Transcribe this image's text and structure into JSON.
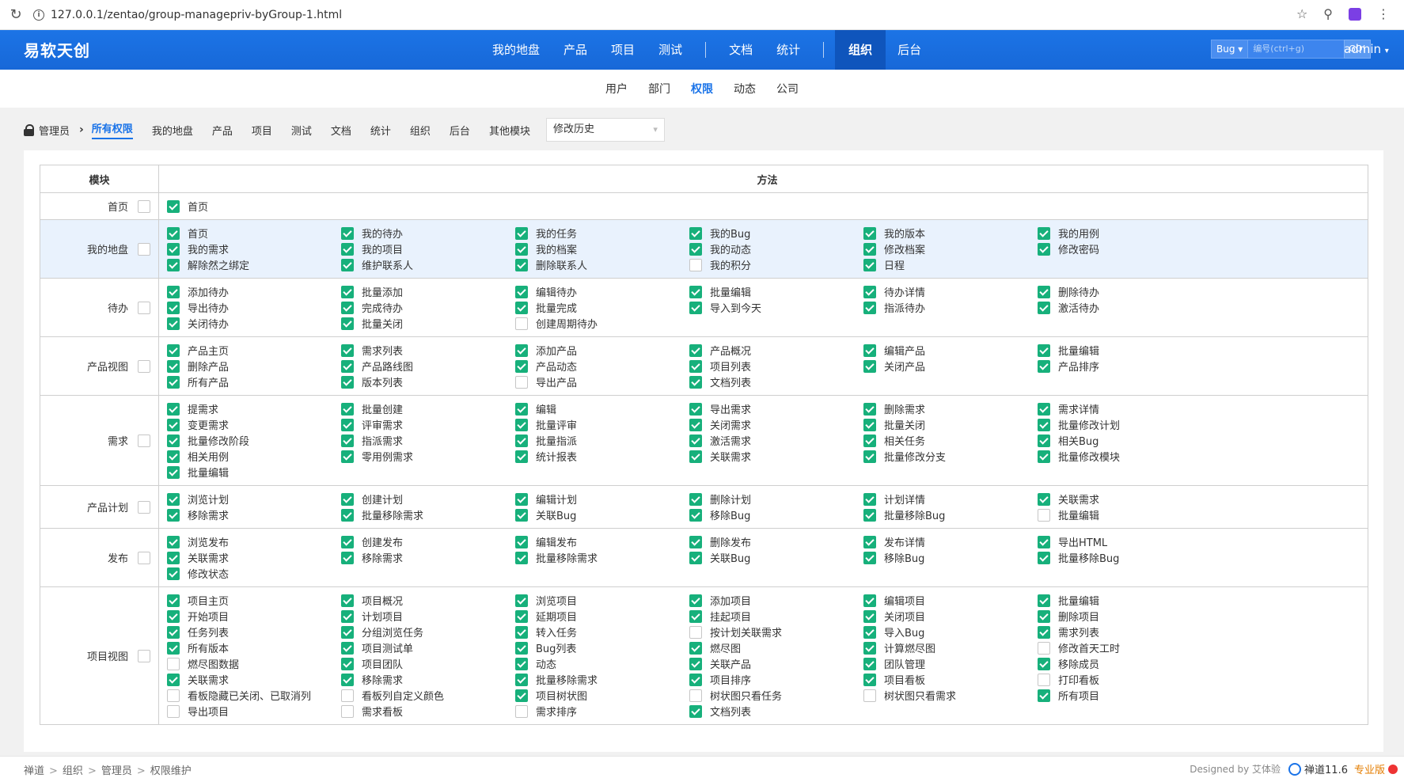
{
  "browser": {
    "url": "127.0.0.1/zentao/group-managepriv-byGroup-1.html"
  },
  "app": {
    "brand": "易软天创",
    "main_nav": [
      "我的地盘",
      "产品",
      "项目",
      "测试",
      "|",
      "文档",
      "统计",
      "|",
      "组织",
      "后台"
    ],
    "main_nav_active": "组织",
    "search": {
      "type": "Bug",
      "placeholder": "编号(ctrl+g)",
      "go": "GO!"
    },
    "user": "admin"
  },
  "sub_nav": {
    "items": [
      "用户",
      "部门",
      "权限",
      "动态",
      "公司"
    ],
    "active": "权限"
  },
  "toolbar": {
    "group": "管理员",
    "items": [
      "所有权限",
      "我的地盘",
      "产品",
      "项目",
      "测试",
      "文档",
      "统计",
      "组织",
      "后台",
      "其他模块"
    ],
    "active": "所有权限",
    "history_select": "修改历史"
  },
  "table": {
    "header_module": "模块",
    "header_method": "方法",
    "rows": [
      {
        "module": "首页",
        "checked": false,
        "items": [
          [
            "首页",
            true
          ]
        ]
      },
      {
        "module": "我的地盘",
        "checked": false,
        "items": [
          [
            "首页",
            true
          ],
          [
            "我的待办",
            true
          ],
          [
            "我的任务",
            true
          ],
          [
            "我的Bug",
            true
          ],
          [
            "我的版本",
            true
          ],
          [
            "我的用例",
            true
          ],
          [
            "我的需求",
            true
          ],
          [
            "我的项目",
            true
          ],
          [
            "我的档案",
            true
          ],
          [
            "我的动态",
            true
          ],
          [
            "修改档案",
            true
          ],
          [
            "修改密码",
            true
          ],
          [
            "解除然之绑定",
            true
          ],
          [
            "维护联系人",
            true
          ],
          [
            "删除联系人",
            true
          ],
          [
            "我的积分",
            false
          ],
          [
            "日程",
            true
          ]
        ]
      },
      {
        "module": "待办",
        "checked": false,
        "items": [
          [
            "添加待办",
            true
          ],
          [
            "批量添加",
            true
          ],
          [
            "编辑待办",
            true
          ],
          [
            "批量编辑",
            true
          ],
          [
            "待办详情",
            true
          ],
          [
            "删除待办",
            true
          ],
          [
            "导出待办",
            true
          ],
          [
            "完成待办",
            true
          ],
          [
            "批量完成",
            true
          ],
          [
            "导入到今天",
            true
          ],
          [
            "指派待办",
            true
          ],
          [
            "激活待办",
            true
          ],
          [
            "关闭待办",
            true
          ],
          [
            "批量关闭",
            true
          ],
          [
            "创建周期待办",
            false
          ]
        ]
      },
      {
        "module": "产品视图",
        "checked": false,
        "items": [
          [
            "产品主页",
            true
          ],
          [
            "需求列表",
            true
          ],
          [
            "添加产品",
            true
          ],
          [
            "产品概况",
            true
          ],
          [
            "编辑产品",
            true
          ],
          [
            "批量编辑",
            true
          ],
          [
            "删除产品",
            true
          ],
          [
            "产品路线图",
            true
          ],
          [
            "产品动态",
            true
          ],
          [
            "项目列表",
            true
          ],
          [
            "关闭产品",
            true
          ],
          [
            "产品排序",
            true
          ],
          [
            "所有产品",
            true
          ],
          [
            "版本列表",
            true
          ],
          [
            "导出产品",
            false
          ],
          [
            "文档列表",
            true
          ]
        ]
      },
      {
        "module": "需求",
        "checked": false,
        "items": [
          [
            "提需求",
            true
          ],
          [
            "批量创建",
            true
          ],
          [
            "编辑",
            true
          ],
          [
            "导出需求",
            true
          ],
          [
            "删除需求",
            true
          ],
          [
            "需求详情",
            true
          ],
          [
            "变更需求",
            true
          ],
          [
            "评审需求",
            true
          ],
          [
            "批量评审",
            true
          ],
          [
            "关闭需求",
            true
          ],
          [
            "批量关闭",
            true
          ],
          [
            "批量修改计划",
            true
          ],
          [
            "批量修改阶段",
            true
          ],
          [
            "指派需求",
            true
          ],
          [
            "批量指派",
            true
          ],
          [
            "激活需求",
            true
          ],
          [
            "相关任务",
            true
          ],
          [
            "相关Bug",
            true
          ],
          [
            "相关用例",
            true
          ],
          [
            "零用例需求",
            true
          ],
          [
            "统计报表",
            true
          ],
          [
            "关联需求",
            true
          ],
          [
            "批量修改分支",
            true
          ],
          [
            "批量修改模块",
            true
          ],
          [
            "批量编辑",
            true
          ]
        ]
      },
      {
        "module": "产品计划",
        "checked": false,
        "items": [
          [
            "浏览计划",
            true
          ],
          [
            "创建计划",
            true
          ],
          [
            "编辑计划",
            true
          ],
          [
            "删除计划",
            true
          ],
          [
            "计划详情",
            true
          ],
          [
            "关联需求",
            true
          ],
          [
            "移除需求",
            true
          ],
          [
            "批量移除需求",
            true
          ],
          [
            "关联Bug",
            true
          ],
          [
            "移除Bug",
            true
          ],
          [
            "批量移除Bug",
            true
          ],
          [
            "批量编辑",
            false
          ]
        ]
      },
      {
        "module": "发布",
        "checked": false,
        "items": [
          [
            "浏览发布",
            true
          ],
          [
            "创建发布",
            true
          ],
          [
            "编辑发布",
            true
          ],
          [
            "删除发布",
            true
          ],
          [
            "发布详情",
            true
          ],
          [
            "导出HTML",
            true
          ],
          [
            "关联需求",
            true
          ],
          [
            "移除需求",
            true
          ],
          [
            "批量移除需求",
            true
          ],
          [
            "关联Bug",
            true
          ],
          [
            "移除Bug",
            true
          ],
          [
            "批量移除Bug",
            true
          ],
          [
            "修改状态",
            true
          ]
        ]
      },
      {
        "module": "项目视图",
        "checked": false,
        "items": [
          [
            "项目主页",
            true
          ],
          [
            "项目概况",
            true
          ],
          [
            "浏览项目",
            true
          ],
          [
            "添加项目",
            true
          ],
          [
            "编辑项目",
            true
          ],
          [
            "批量编辑",
            true
          ],
          [
            "开始项目",
            true
          ],
          [
            "计划项目",
            true
          ],
          [
            "延期项目",
            true
          ],
          [
            "挂起项目",
            true
          ],
          [
            "关闭项目",
            true
          ],
          [
            "删除项目",
            true
          ],
          [
            "任务列表",
            true
          ],
          [
            "分组浏览任务",
            true
          ],
          [
            "转入任务",
            true
          ],
          [
            "按计划关联需求",
            false
          ],
          [
            "导入Bug",
            true
          ],
          [
            "需求列表",
            true
          ],
          [
            "所有版本",
            true
          ],
          [
            "项目测试单",
            true
          ],
          [
            "Bug列表",
            true
          ],
          [
            "燃尽图",
            true
          ],
          [
            "计算燃尽图",
            true
          ],
          [
            "修改首天工时",
            false
          ],
          [
            "燃尽图数据",
            false
          ],
          [
            "项目团队",
            true
          ],
          [
            "动态",
            true
          ],
          [
            "关联产品",
            true
          ],
          [
            "团队管理",
            true
          ],
          [
            "移除成员",
            true
          ],
          [
            "关联需求",
            true
          ],
          [
            "移除需求",
            true
          ],
          [
            "批量移除需求",
            true
          ],
          [
            "项目排序",
            true
          ],
          [
            "项目看板",
            true
          ],
          [
            "打印看板",
            false
          ],
          [
            "看板隐藏已关闭、已取消列",
            false
          ],
          [
            "看板列自定义颜色",
            false
          ],
          [
            "项目树状图",
            true
          ],
          [
            "树状图只看任务",
            false
          ],
          [
            "树状图只看需求",
            false
          ],
          [
            "所有项目",
            true
          ],
          [
            "导出项目",
            false
          ],
          [
            "需求看板",
            false
          ],
          [
            "需求排序",
            false
          ],
          [
            "文档列表",
            true
          ]
        ]
      }
    ]
  },
  "footer": {
    "breadcrumbs": [
      "禅道",
      "组织",
      "管理员",
      "权限维护"
    ],
    "designed_by": "Designed by 艾体验",
    "version": "禅道11.6",
    "edition": "专业版"
  },
  "colors": {
    "brand_blue": "#1a73e8",
    "check_green": "#17b07b",
    "row_highlight": "#e9f2fd"
  }
}
